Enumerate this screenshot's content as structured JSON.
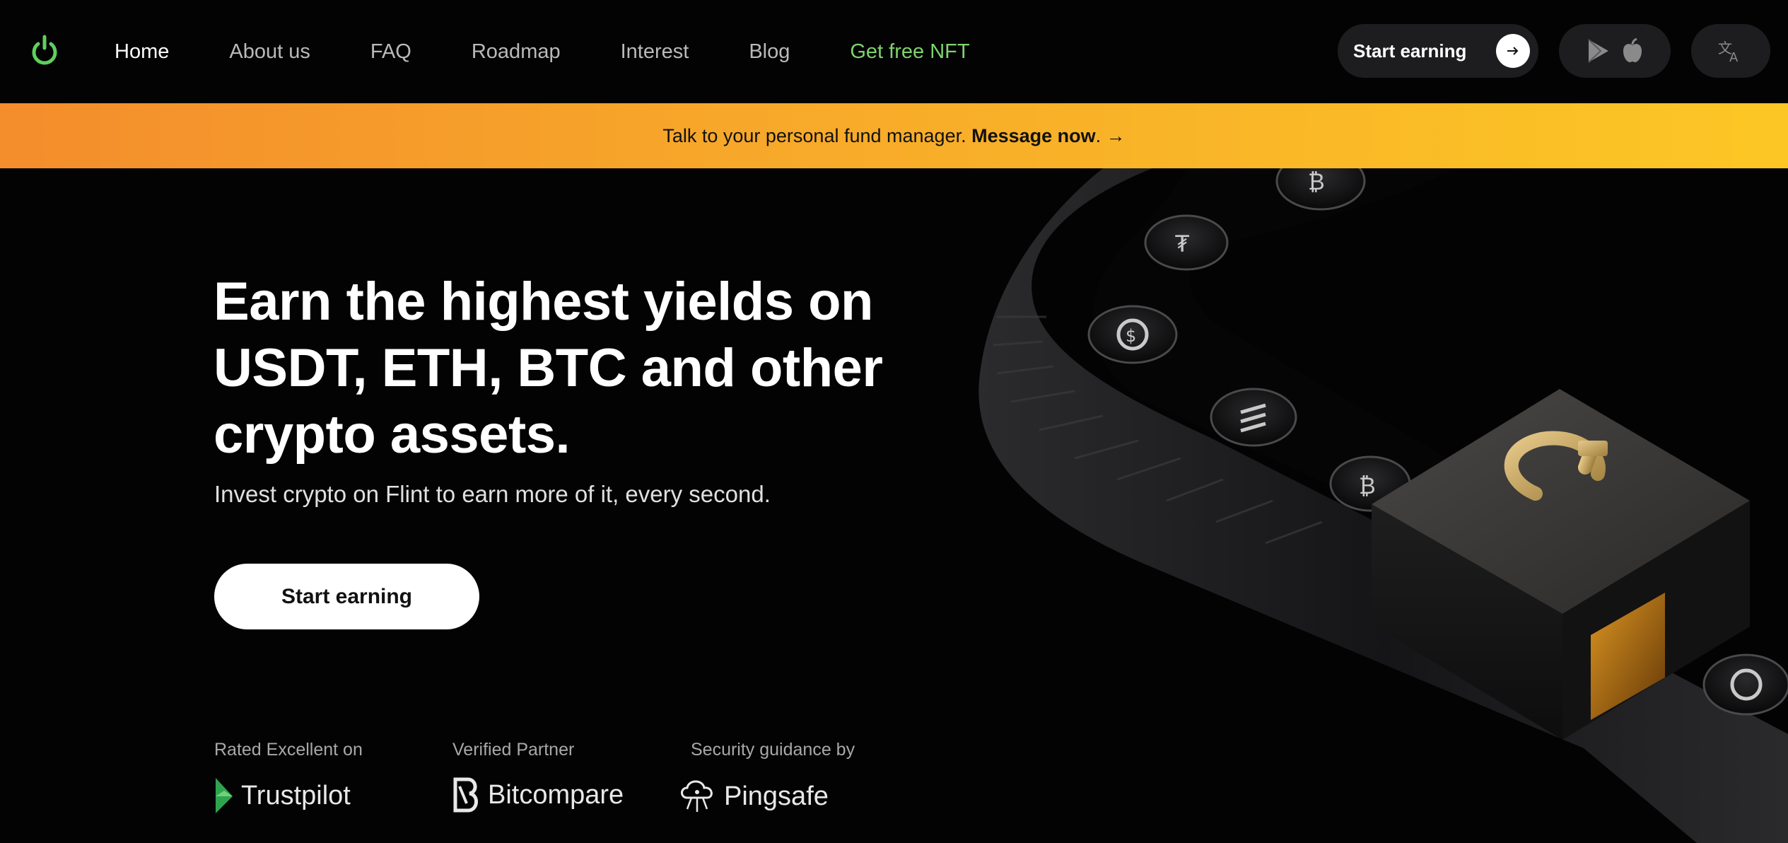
{
  "nav": {
    "logo_icon": "flint-logo-icon",
    "links": [
      {
        "label": "Home",
        "state": "active"
      },
      {
        "label": "About us",
        "state": "normal"
      },
      {
        "label": "FAQ",
        "state": "normal"
      },
      {
        "label": "Roadmap",
        "state": "normal"
      },
      {
        "label": "Interest",
        "state": "normal"
      },
      {
        "label": "Blog",
        "state": "normal"
      },
      {
        "label": "Get free NFT",
        "state": "accent"
      }
    ],
    "start_earning_label": "Start earning",
    "start_earning_icon": "arrow-right-icon",
    "app_icons": [
      "google-play-icon",
      "apple-icon"
    ],
    "language_icon": "translate-icon"
  },
  "banner": {
    "text": "Talk to your personal fund manager. ",
    "link_label": "Message now",
    "suffix": ". →"
  },
  "hero": {
    "headline": "Earn the highest yields on USDT, ETH, BTC and other crypto assets.",
    "subline": "Invest crypto on Flint to earn more of it, every second.",
    "cta_label": "Start earning"
  },
  "trust": [
    {
      "label": "Rated Excellent on",
      "name": "Trustpilot",
      "icon": "trustpilot-icon"
    },
    {
      "label": "Verified Partner",
      "name": "Bitcompare",
      "icon": "bitcompare-icon"
    },
    {
      "label": "Security guidance by",
      "name": "Pingsafe",
      "icon": "pingsafe-icon"
    }
  ],
  "colors": {
    "background": "#030304",
    "accent_green": "#7ed36c",
    "banner_start": "#f48d2c",
    "banner_end": "#fcc725",
    "logo_gold": "#c9a560"
  }
}
